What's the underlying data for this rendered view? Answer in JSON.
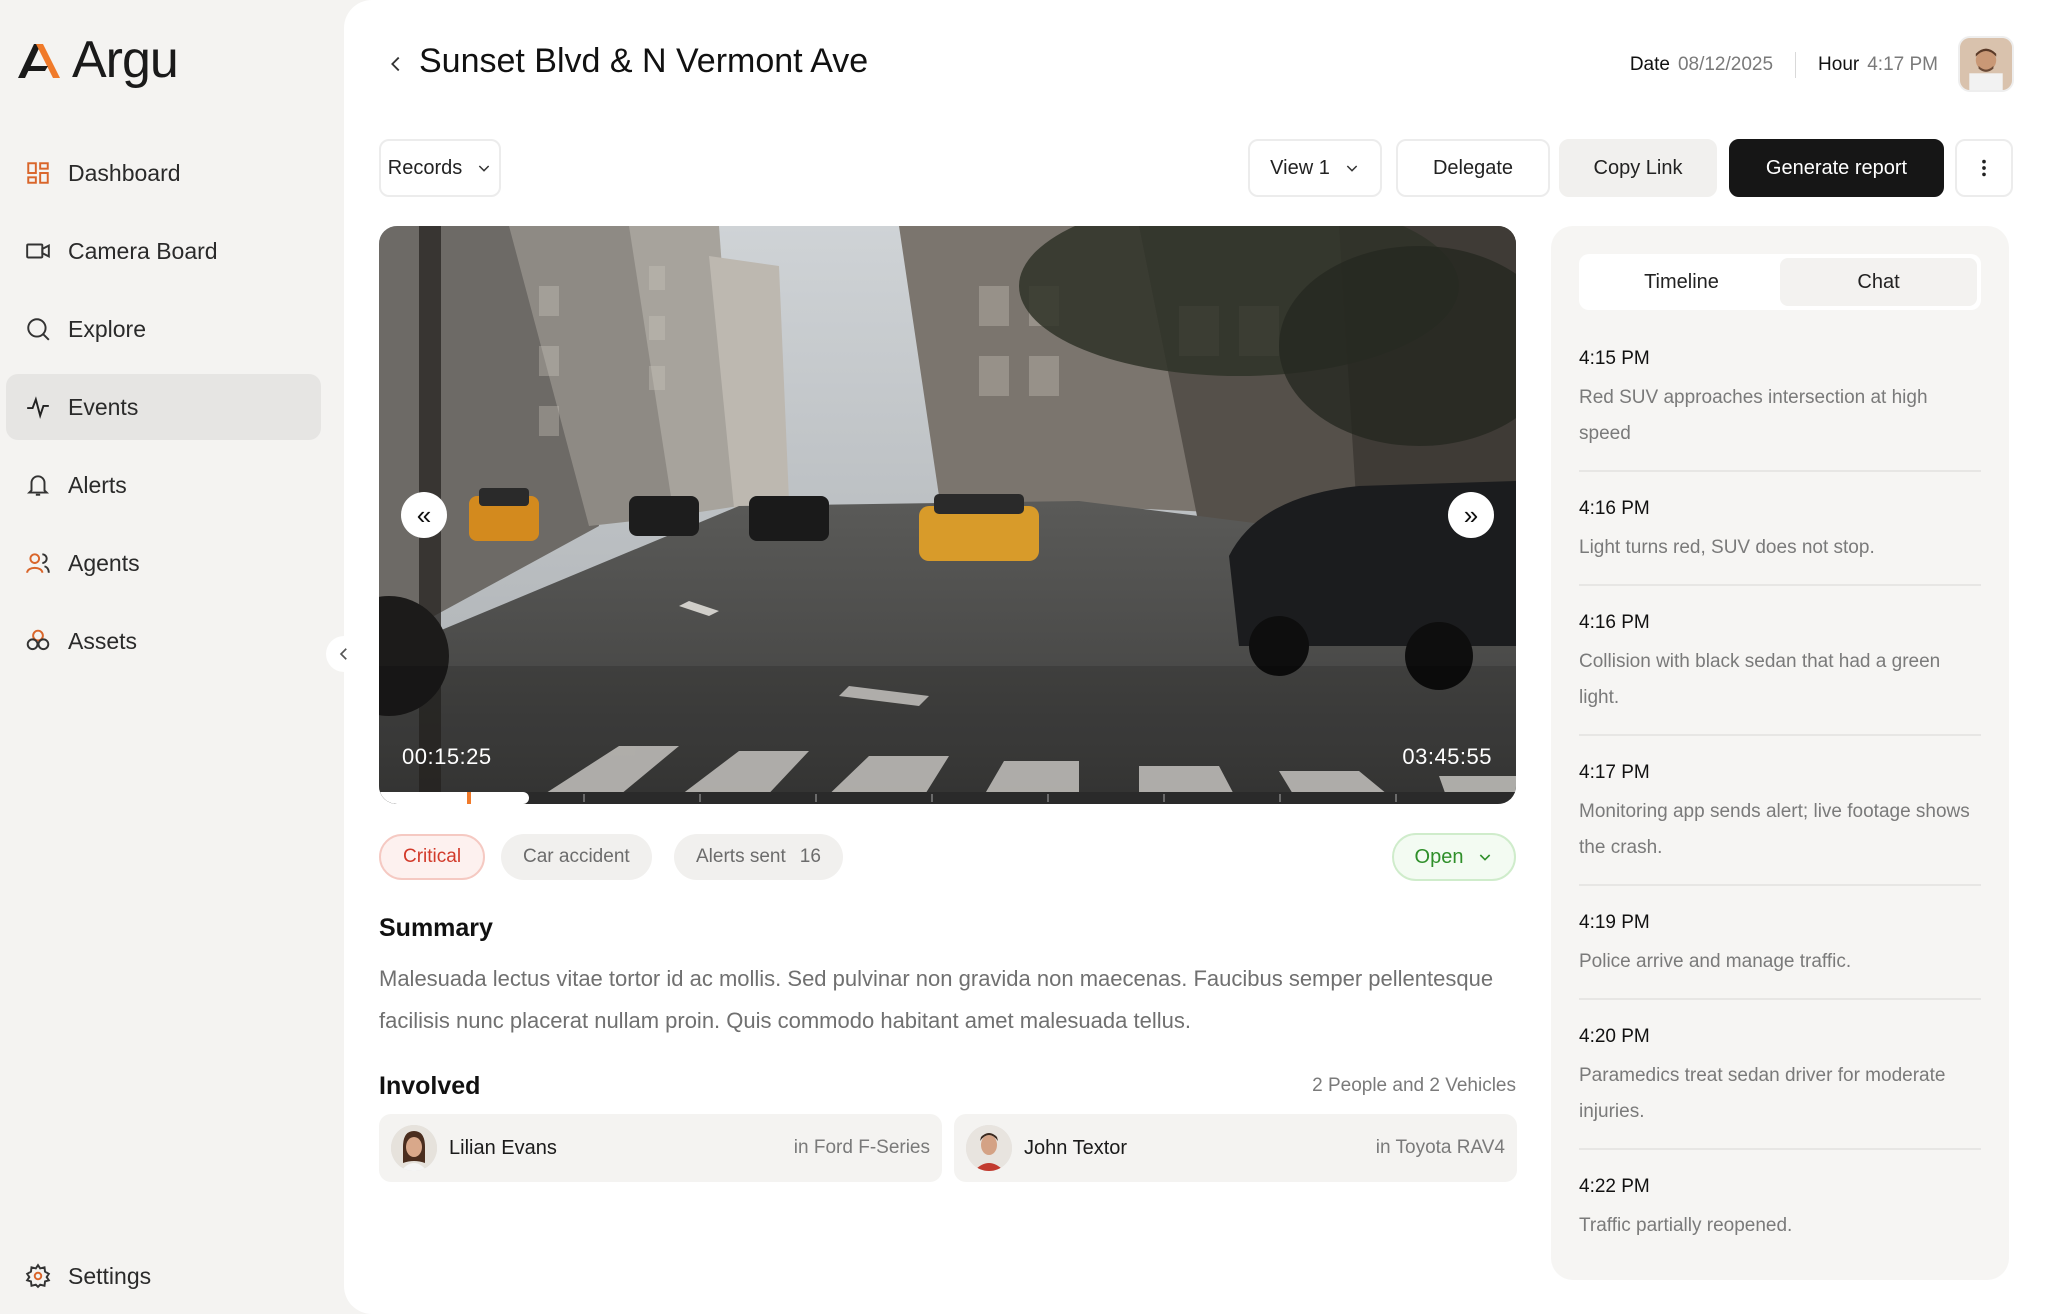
{
  "app": {
    "name": "Argu",
    "accent_color": "#f07a2a"
  },
  "sidebar": {
    "items": [
      {
        "label": "Dashboard",
        "icon": "dashboard-icon"
      },
      {
        "label": "Camera Board",
        "icon": "camera-icon"
      },
      {
        "label": "Explore",
        "icon": "search-icon"
      },
      {
        "label": "Events",
        "icon": "activity-icon",
        "active": true
      },
      {
        "label": "Alerts",
        "icon": "bell-icon"
      },
      {
        "label": "Agents",
        "icon": "users-icon"
      },
      {
        "label": "Assets",
        "icon": "assets-icon"
      }
    ],
    "settings_label": "Settings"
  },
  "header": {
    "title": "Sunset Blvd & N Vermont Ave",
    "date_label": "Date",
    "date_value": "08/12/2025",
    "hour_label": "Hour",
    "hour_value": "4:17 PM"
  },
  "toolbar": {
    "records_label": "Records",
    "view_label": "View 1",
    "delegate_label": "Delegate",
    "copy_link_label": "Copy Link",
    "generate_label": "Generate report"
  },
  "video": {
    "current_time": "00:15:25",
    "total_time": "03:45:55"
  },
  "tags": {
    "severity": "Critical",
    "type": "Car accident",
    "alerts_label": "Alerts sent",
    "alerts_count": "16",
    "status": "Open"
  },
  "summary": {
    "heading": "Summary",
    "text": "Malesuada lectus vitae tortor id ac mollis. Sed pulvinar non gravida non maecenas. Faucibus semper pellentesque facilisis nunc placerat nullam proin. Quis commodo habitant amet malesuada tellus."
  },
  "involved": {
    "heading": "Involved",
    "count": "2 People and 2 Vehicles",
    "people": [
      {
        "name": "Lilian Evans",
        "vehicle": "in Ford F-Series"
      },
      {
        "name": "John Textor",
        "vehicle": "in Toyota RAV4"
      }
    ]
  },
  "panel": {
    "tabs": [
      "Timeline",
      "Chat"
    ],
    "events": [
      {
        "time": "4:15 PM",
        "text": "Red SUV approaches intersection at high speed"
      },
      {
        "time": "4:16 PM",
        "text": "Light turns red, SUV does not stop."
      },
      {
        "time": "4:16 PM",
        "text": "Collision with black sedan that had a green light."
      },
      {
        "time": "4:17 PM",
        "text": "Monitoring app sends alert; live footage shows the crash."
      },
      {
        "time": "4:19 PM",
        "text": "Police arrive and manage traffic."
      },
      {
        "time": "4:20 PM",
        "text": "Paramedics treat sedan driver for moderate injuries."
      },
      {
        "time": "4:22 PM",
        "text": "Traffic partially reopened."
      }
    ]
  }
}
